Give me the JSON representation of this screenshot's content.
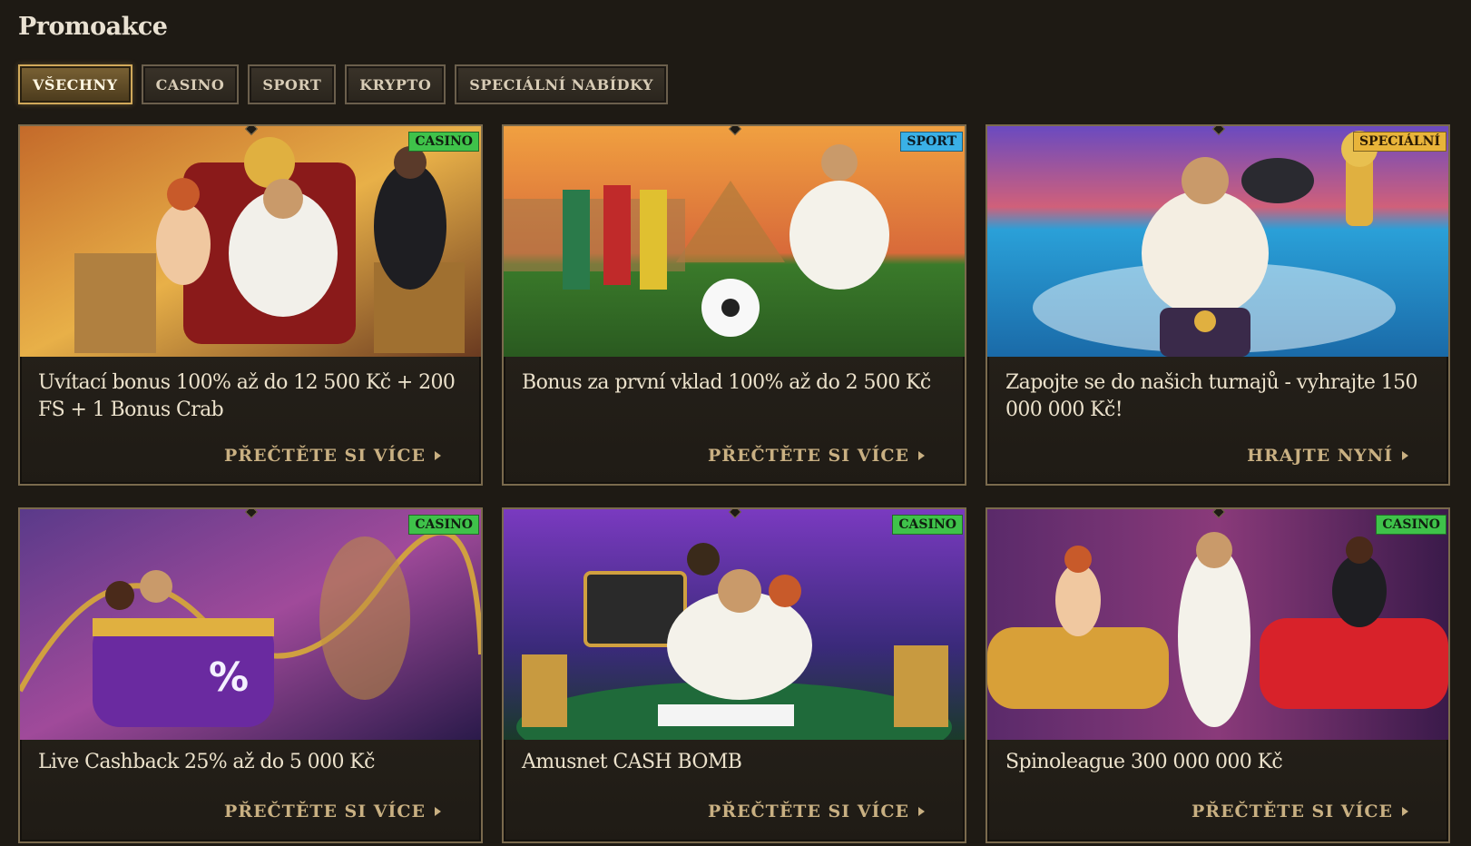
{
  "page": {
    "title": "Promoakce"
  },
  "tabs": [
    {
      "label": "VŠECHNY",
      "active": true
    },
    {
      "label": "CASINO",
      "active": false
    },
    {
      "label": "SPORT",
      "active": false
    },
    {
      "label": "KRYPTO",
      "active": false
    },
    {
      "label": "SPECIÁLNÍ NABÍDKY",
      "active": false
    }
  ],
  "promos": [
    {
      "badge": "CASINO",
      "badge_type": "casino",
      "title": "Uvítací bonus 100% až do 12 500 Kč + 200 FS + 1 Bonus Crab",
      "cta": "PŘEČTĚTE SI VÍCE",
      "art": "pharaoh-throne-scene"
    },
    {
      "badge": "SPORT",
      "badge_type": "sport",
      "title": "Bonus za první vklad 100% až do 2 500 Kč",
      "cta": "PŘEČTĚTE SI VÍCE",
      "art": "pharaoh-football-kick-scene"
    },
    {
      "badge": "SPECIÁLNÍ",
      "badge_type": "special",
      "title": "Zapojte se do našich turnajů - vyhrajte 150 000 000 Kč!",
      "cta": "HRAJTE NYNÍ",
      "art": "pharaoh-jetski-trophy-scene"
    },
    {
      "badge": "CASINO",
      "badge_type": "casino",
      "title": "Live Cashback 25% až do 5 000 Kč",
      "cta": "PŘEČTĚTE SI VÍCE",
      "art": "rollercoaster-cashback-scene"
    },
    {
      "badge": "CASINO",
      "badge_type": "casino",
      "title": "Amusnet CASH BOMB",
      "cta": "PŘEČTĚTE SI VÍCE",
      "art": "poker-table-scene"
    },
    {
      "badge": "CASINO",
      "badge_type": "casino",
      "title": "Spinoleague 300 000 000 Kč",
      "cta": "PŘEČTĚTE SI VÍCE",
      "art": "sports-cars-money-scene"
    }
  ],
  "colors": {
    "background": "#1e1a14",
    "accent_gold": "#d1a95a",
    "badge_casino": "#3fc24a",
    "badge_sport": "#3ab0e6",
    "badge_special": "#e8b43a"
  }
}
